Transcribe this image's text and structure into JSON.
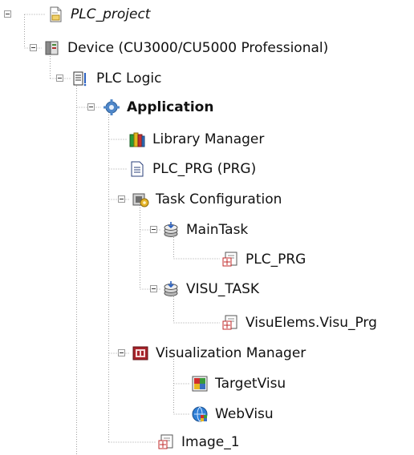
{
  "tree": {
    "project": {
      "label": "PLC_project",
      "icon": "project-document-icon"
    },
    "device": {
      "label": "Device (CU3000/CU5000 Professional)",
      "icon": "device-icon"
    },
    "plc_logic": {
      "label": "PLC Logic",
      "icon": "plc-logic-icon"
    },
    "application": {
      "label": "Application",
      "icon": "application-gear-icon"
    },
    "library_manager": {
      "label": "Library Manager",
      "icon": "library-books-icon"
    },
    "plc_prg_prg": {
      "label": "PLC_PRG (PRG)",
      "icon": "program-document-icon"
    },
    "task_configuration": {
      "label": "Task Configuration",
      "icon": "task-configuration-icon"
    },
    "main_task": {
      "label": "MainTask",
      "icon": "task-icon"
    },
    "main_task_plc_prg": {
      "label": "PLC_PRG",
      "icon": "program-call-icon"
    },
    "visu_task": {
      "label": "VISU_TASK",
      "icon": "task-icon"
    },
    "visu_elems": {
      "label": "VisuElems.Visu_Prg",
      "icon": "program-call-icon"
    },
    "visualization_manager": {
      "label": "Visualization Manager",
      "icon": "visualization-manager-icon"
    },
    "target_visu": {
      "label": "TargetVisu",
      "icon": "target-visu-icon"
    },
    "web_visu": {
      "label": "WebVisu",
      "icon": "web-visu-icon"
    },
    "image_1": {
      "label": "Image_1",
      "icon": "image-pool-icon"
    }
  }
}
